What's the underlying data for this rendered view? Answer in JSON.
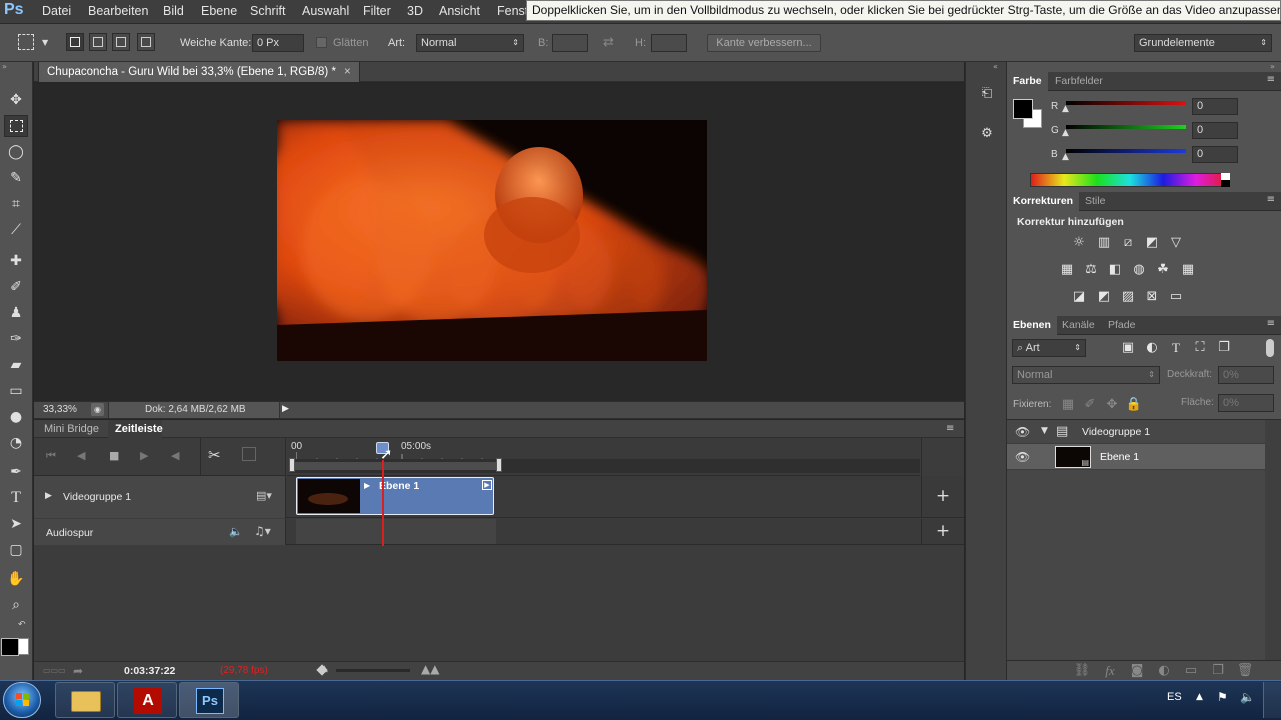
{
  "app": {
    "logo": "Ps"
  },
  "menu": {
    "items": [
      "Datei",
      "Bearbeiten",
      "Bild",
      "Ebene",
      "Schrift",
      "Auswahl",
      "Filter",
      "3D",
      "Ansicht",
      "Fenst"
    ]
  },
  "tooltip": "Doppelklicken Sie, um in den Vollbildmodus zu wechseln, oder klicken Sie bei gedrückter Strg-Taste, um die Größe an das Video anzupassen.",
  "options": {
    "feather_label": "Weiche Kante:",
    "feather_value": "0 Px",
    "antialias_label": "Glätten",
    "style_label": "Art:",
    "style_value": "Normal",
    "width_label": "B:",
    "height_label": "H:",
    "refine_button": "Kante verbessern...",
    "workspace": "Grundelemente"
  },
  "document": {
    "tab_title": "Chupaconcha - Guru Wild bei 33,3% (Ebene 1, RGB/8) *",
    "zoom": "33,33%",
    "doc_info": "Dok: 2,64 MB/2,62 MB"
  },
  "timeline": {
    "tabs": [
      "Mini Bridge",
      "Zeitleiste"
    ],
    "ruler_start": "00",
    "ruler_mark": "05:00s",
    "tracks": [
      {
        "name": "Videogruppe 1"
      },
      {
        "name": "Audiospur"
      }
    ],
    "clip_label": "Ebene 1",
    "current_time": "0:03:37:22",
    "fps": "(29,78 fps)"
  },
  "color_panel": {
    "tabs": [
      "Farbe",
      "Farbfelder"
    ],
    "channels": [
      {
        "label": "R",
        "value": "0",
        "color": "#d21c1c"
      },
      {
        "label": "G",
        "value": "0",
        "color": "#1fb41f"
      },
      {
        "label": "B",
        "value": "0",
        "color": "#1c2fd2"
      }
    ]
  },
  "adjustments_panel": {
    "tabs": [
      "Korrekturen",
      "Stile"
    ],
    "heading": "Korrektur hinzufügen"
  },
  "layers_panel": {
    "tabs": [
      "Ebenen",
      "Kanäle",
      "Pfade"
    ],
    "filter": "Art",
    "blend_mode": "Normal",
    "opacity_label": "Deckkraft:",
    "opacity_value": "0%",
    "lock_label": "Fixieren:",
    "fill_label": "Fläche:",
    "fill_value": "0%",
    "layers": [
      {
        "name": "Videogruppe 1"
      },
      {
        "name": "Ebene 1"
      }
    ]
  },
  "taskbar": {
    "language": "ES"
  }
}
